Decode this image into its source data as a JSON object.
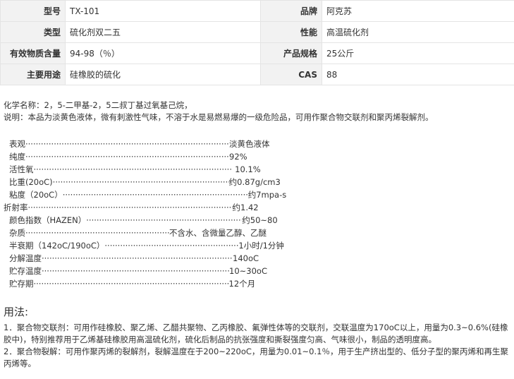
{
  "spec": [
    {
      "k1": "型号",
      "v1": "TX-101",
      "k2": "品牌",
      "v2": "阿克苏"
    },
    {
      "k1": "类型",
      "v1": "硫化剂双二五",
      "k2": "性能",
      "v2": "高温硫化剂"
    },
    {
      "k1": "有效物质含量",
      "v1": "94-98（％）",
      "k2": "产品规格",
      "v2": "25公斤"
    },
    {
      "k1": "主要用途",
      "v1": "硅橡胶的硫化",
      "k2": "CAS",
      "v2": "88"
    }
  ],
  "chemical_name": "化学名称：2，5-二甲基-2，5二叔丁基过氧基己烷，",
  "description": "说明：本品为淡黄色液体，微有刺激性气味，不溶于水是易燃易爆的一级危险品，可用作聚合物交联剂和聚丙烯裂解剂。",
  "properties": [
    {
      "name": "表观",
      "value": "淡黄色液体"
    },
    {
      "name": "纯度",
      "value": "92%"
    },
    {
      "name": "活性氧",
      "value": " 10.1%"
    },
    {
      "name": "比重(20oC)",
      "value": "约0.87g/cm3"
    },
    {
      "name": "粘度（20oC）",
      "value": "约7mpa-s"
    },
    {
      "name": "折射率",
      "value": "约1.42"
    },
    {
      "name": "颜色指数（HAZEN）",
      "value": "约50~80"
    },
    {
      "name": "杂质",
      "value": "不含水、含微量乙醇、乙醚"
    },
    {
      "name": "半衰期（142oC/190oC）",
      "value": "1小时/1分钟"
    },
    {
      "name": "分解温度",
      "value": "140oC"
    },
    {
      "name": "贮存温度",
      "value": "10~30oC"
    },
    {
      "name": "贮存期",
      "value": "12个月"
    }
  ],
  "usage_heading": "用法:",
  "usage": [
    "1．聚合物交联剂：可用作硅橡胶、聚乙烯、乙醋共聚物、乙丙橡胶、氟弹性体等的交联剂，交联温度为170oC以上，用量为0.3~0.6%(硅橡胶中)，特别推荐用于乙烯基硅橡胶用高温硫化剂，硫化后制品的抗张强度和撕裂强度匀高、气味很小，制品的透明度高。",
    "2．聚合物裂解：可用作聚丙烯的裂解剂，裂解温度在于200~220oC，用量为0.01~0.1％，用于生产挤出型的、低分子型的聚丙烯和再生聚丙烯等。"
  ]
}
